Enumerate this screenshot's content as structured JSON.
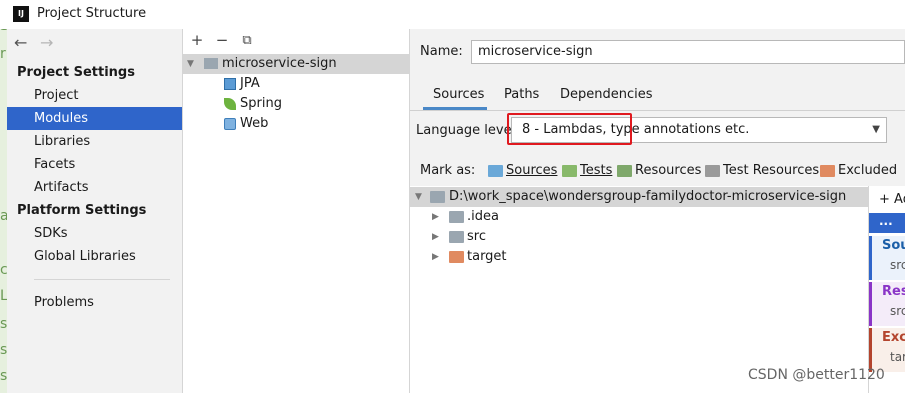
{
  "window": {
    "title": "Project Structure",
    "logo": "IJ"
  },
  "behind_window_glyphs": [
    "e",
    "S",
    "r",
    "a",
    "c",
    "L",
    "s",
    "s",
    "s"
  ],
  "nav": {
    "back": "←",
    "forward": "→"
  },
  "sidebar": {
    "project_settings_header": "Project Settings",
    "project_items": [
      "Project",
      "Modules",
      "Libraries",
      "Facets",
      "Artifacts"
    ],
    "platform_settings_header": "Platform Settings",
    "platform_items": [
      "SDKs",
      "Global Libraries"
    ],
    "problems": "Problems",
    "selected": "Modules"
  },
  "modules_toolbar": {
    "add": "+",
    "remove": "−",
    "copy": "⧉"
  },
  "modules_tree": {
    "root": "microservice-sign",
    "children": [
      "JPA",
      "Spring",
      "Web"
    ]
  },
  "detail": {
    "name_label": "Name:",
    "name_value": "microservice-sign",
    "tabs": [
      "Sources",
      "Paths",
      "Dependencies"
    ],
    "active_tab": "Sources",
    "language_level_label": "Language level:",
    "language_level_value": "8 - Lambdas, type annotations etc.",
    "mark_as_label": "Mark as:",
    "mark_as": [
      {
        "label": "Sources",
        "color": "#6aa8d8"
      },
      {
        "label": "Tests",
        "color": "#88b96a"
      },
      {
        "label": "Resources",
        "color": "#7fa86b"
      },
      {
        "label": "Test Resources",
        "color": "#9a9a9a"
      },
      {
        "label": "Excluded",
        "color": "#e08a60"
      }
    ],
    "content_root": "D:\\work_space\\wondersgroup-familydoctor-microservice-sign",
    "content_children": [
      ".idea",
      "src",
      "target"
    ],
    "right_panel": {
      "add_label": "+ Ad",
      "dots": "...",
      "sources_header": "Sour",
      "sources_path": "src\\",
      "resources_header": "Reso",
      "resources_path": "src\\",
      "excluded_header": "Exclu",
      "excluded_path": "targ"
    }
  },
  "watermark": "CSDN @better1120",
  "colors": {
    "selection": "#2f65ca",
    "highlight_box": "#e0191f",
    "tab_underline": "#4a88c7"
  }
}
